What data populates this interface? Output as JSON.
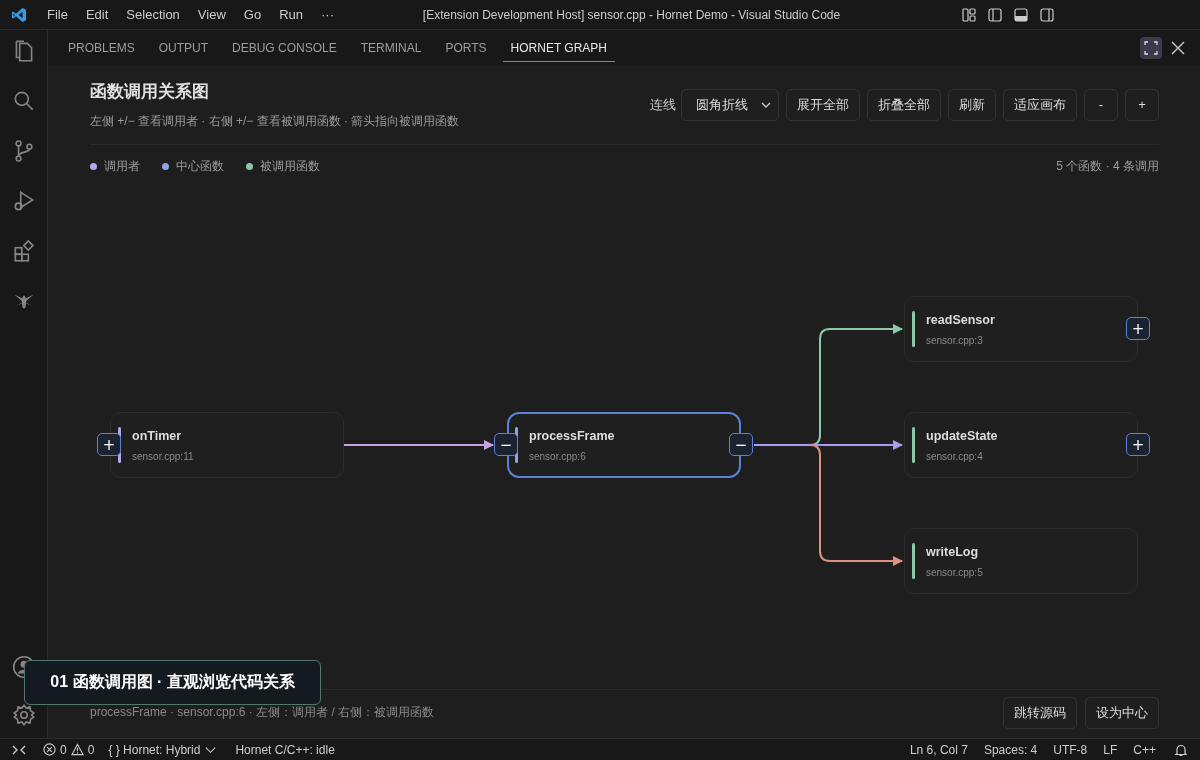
{
  "window": {
    "title": "[Extension Development Host] sensor.cpp - Hornet Demo - Visual Studio Code"
  },
  "menu": [
    "File",
    "Edit",
    "Selection",
    "View",
    "Go",
    "Run",
    "···"
  ],
  "panel_tabs": [
    {
      "label": "PROBLEMS",
      "selected": false
    },
    {
      "label": "OUTPUT",
      "selected": false
    },
    {
      "label": "DEBUG CONSOLE",
      "selected": false
    },
    {
      "label": "TERMINAL",
      "selected": false
    },
    {
      "label": "PORTS",
      "selected": false
    },
    {
      "label": "HORNET GRAPH",
      "selected": true
    }
  ],
  "graph_view": {
    "title": "函数调用关系图",
    "subtitle": "左侧 +/− 查看调用者 · 右侧 +/− 查看被调用函数 · 箭头指向被调用函数",
    "edge_style": {
      "label": "连线",
      "value": "圆角折线"
    },
    "buttons": [
      "展开全部",
      "折叠全部",
      "刷新",
      "适应画布",
      "-",
      "+"
    ],
    "legend": [
      {
        "label": "调用者",
        "color": "#b4a8ec"
      },
      {
        "label": "中心函数",
        "color": "#8fa2e6"
      },
      {
        "label": "被调用函数",
        "color": "#8cc7a8"
      }
    ],
    "stats": "5 个函数 · 4 条调用",
    "center": {
      "name": "processFrame",
      "file": "sensor.cpp:6",
      "left_toggle": "−",
      "right_toggle": "−"
    },
    "callers": [
      {
        "name": "onTimer",
        "file": "sensor.cpp:11",
        "toggle": "+",
        "color": "#c9a0e6"
      }
    ],
    "callees": [
      {
        "name": "readSensor",
        "file": "sensor.cpp:3",
        "toggle": "+",
        "color": "#8cc7a8"
      },
      {
        "name": "updateState",
        "file": "sensor.cpp:4",
        "toggle": "+",
        "color": "#a99cf0"
      },
      {
        "name": "writeLog",
        "file": "sensor.cpp:5",
        "color": "#e0907e"
      }
    ],
    "detail": "processFrame · sensor.cpp:6 · 左侧：调用者 / 右侧：被调用函数",
    "actions": [
      "跳转源码",
      "设为中心"
    ]
  },
  "caption": "01 函数调用图 · 直观浏览代码关系",
  "status_bar": {
    "errors": "0",
    "warnings": "0",
    "mode": "{ } Hornet: Hybrid",
    "engine": "Hornet C/C++: idle",
    "right": [
      "Ln 6, Col 7",
      "Spaces: 4",
      "UTF-8",
      "LF",
      "C++"
    ]
  }
}
